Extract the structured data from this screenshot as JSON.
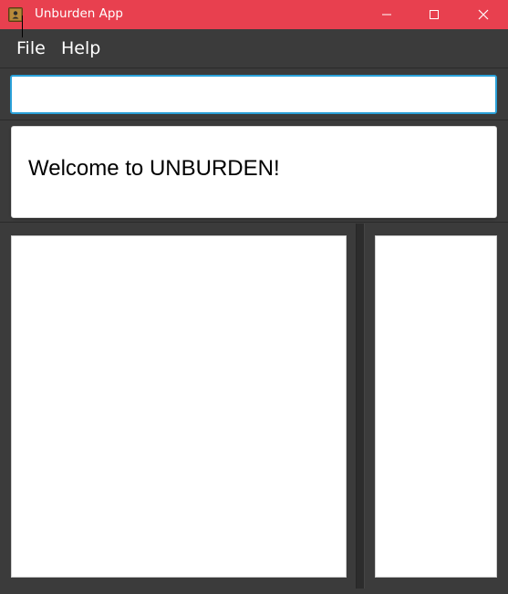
{
  "window": {
    "title": "Unburden App",
    "icon": "contact-book-icon",
    "titlebar_color": "#e8404f",
    "controls": [
      "minimize-icon",
      "maximize-icon",
      "close-icon"
    ]
  },
  "menubar": {
    "items": [
      {
        "label": "File"
      },
      {
        "label": "Help"
      }
    ]
  },
  "command_box": {
    "value": "",
    "placeholder": "",
    "focus_color": "#2aa1d9"
  },
  "result_display": {
    "text": "Welcome to UNBURDEN!"
  },
  "theme": {
    "background": "#3b3b3b",
    "panel": "#ffffff"
  }
}
